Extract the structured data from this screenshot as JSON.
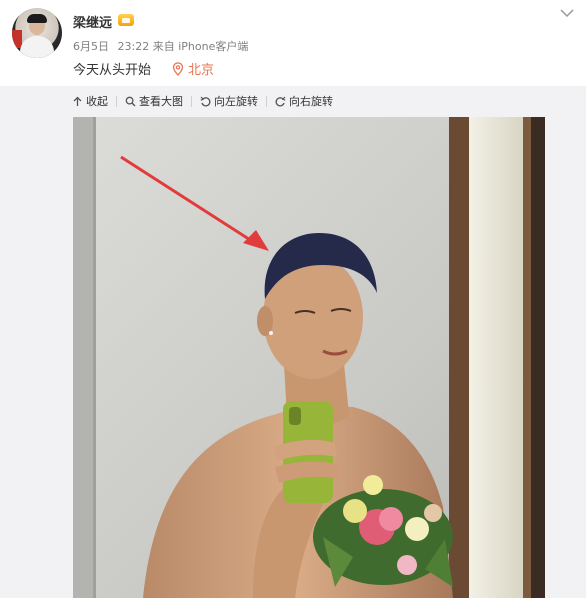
{
  "post": {
    "username": "梁继远",
    "date": "6月5日",
    "time": "23:22",
    "source_prefix": "来自",
    "source": "iPhone客户端",
    "text": "今天从头开始",
    "location": "北京"
  },
  "toolbar": {
    "collapse_label": "收起",
    "view_large_label": "查看大图",
    "rotate_left_label": "向左旋转",
    "rotate_right_label": "向右旋转"
  },
  "icons": {
    "avatar": "avatar-image",
    "vip": "vip-badge-icon",
    "location": "location-pin-icon",
    "menu": "chevron-down-icon",
    "collapse": "arrow-up-icon",
    "view_large": "magnifier-icon",
    "rotate_left": "rotate-left-icon",
    "rotate_right": "rotate-right-icon"
  },
  "colors": {
    "location": "#eb7350",
    "panel": "#f2f2f5",
    "arrow": "#e23b3b"
  }
}
